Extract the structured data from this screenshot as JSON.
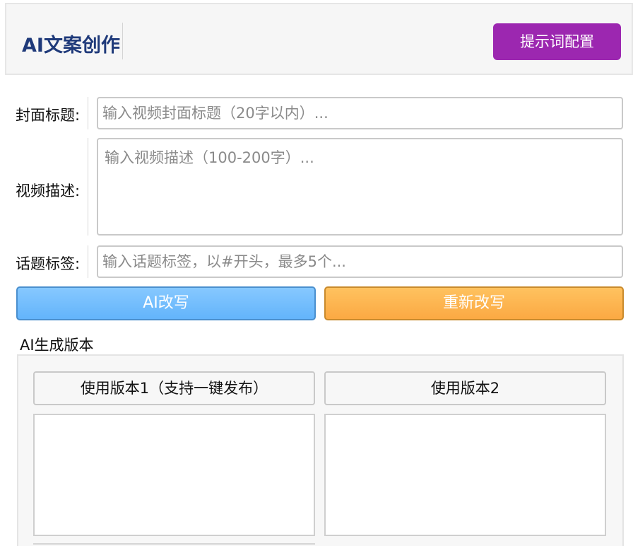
{
  "header": {
    "title": "AI文案创作",
    "prompt_config_label": "提示词配置"
  },
  "form": {
    "cover_title": {
      "label": "封面标题:",
      "value": "",
      "placeholder": "输入视频封面标题（20字以内）..."
    },
    "video_desc": {
      "label": "视频描述:",
      "value": "",
      "placeholder": "输入视频描述（100-200字）..."
    },
    "topic_tags": {
      "label": "话题标签:",
      "value": "",
      "placeholder": "输入话题标签，以#开头，最多5个..."
    }
  },
  "actions": {
    "ai_rewrite_label": "AI改写",
    "re_rewrite_label": "重新改写"
  },
  "versions": {
    "section_title": "AI生成版本",
    "items": [
      {
        "button_label": "使用版本1（支持一键发布）",
        "content": ""
      },
      {
        "button_label": "使用版本2",
        "content": ""
      }
    ]
  },
  "colors": {
    "title_text": "#1f3a7a",
    "prompt_button": "#9c27b0",
    "ai_rewrite_button": "#63b4fb",
    "re_rewrite_button": "#fba943"
  }
}
